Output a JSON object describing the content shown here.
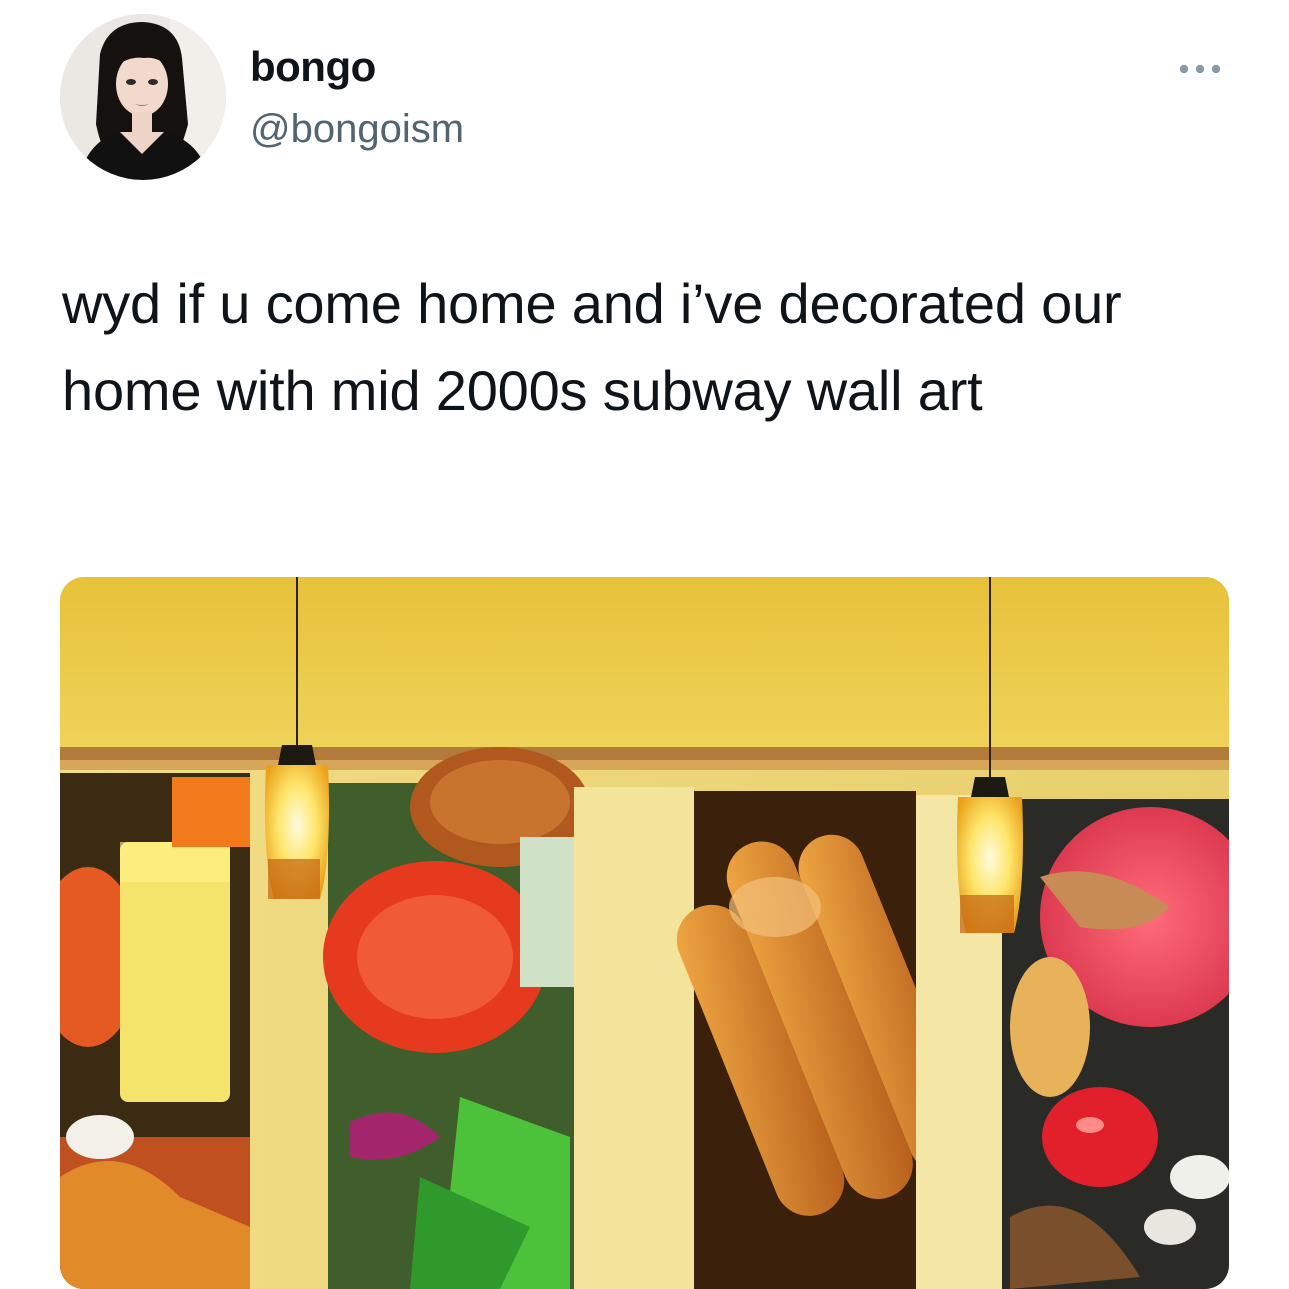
{
  "author": {
    "display_name": "bongo",
    "handle": "@bongoism",
    "avatar_icon": "profile-photo"
  },
  "more_icon": "more-horizontal-icon",
  "tweet": {
    "text": "wyd if u come home and i’ve decorated our home with mid 2000s subway wall art"
  },
  "media": {
    "description_icon": "photo-restaurant-wall-art"
  },
  "colors": {
    "text": "#0f1419",
    "secondary_text": "#536471",
    "wall_yellow": "#e8c53c",
    "trim_brown": "#a8733a"
  }
}
